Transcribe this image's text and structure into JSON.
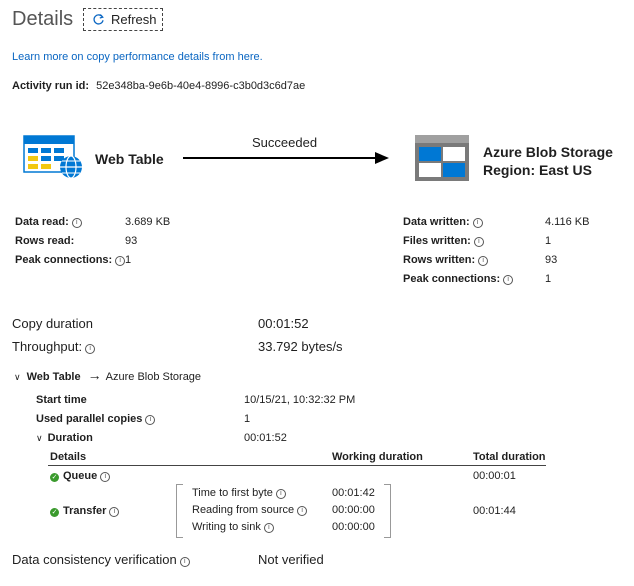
{
  "header": {
    "title": "Details",
    "refresh_label": "Refresh"
  },
  "link_text": "Learn more on copy performance details from here.",
  "activity_run": {
    "label": "Activity run id:",
    "value": "52e348ba-9e6b-40e4-8996-c3b0d3c6d7ae"
  },
  "flow": {
    "source": "Web Table",
    "destination_line1": "Azure Blob Storage",
    "destination_line2": "Region: East US",
    "status": "Succeeded"
  },
  "source_stats": [
    {
      "label": "Data read:",
      "value": "3.689 KB"
    },
    {
      "label": "Rows read:",
      "value": "93"
    },
    {
      "label": "Peak connections:",
      "value": "1"
    }
  ],
  "dest_stats": [
    {
      "label": "Data written:",
      "value": "4.116 KB"
    },
    {
      "label": "Files written:",
      "value": "1"
    },
    {
      "label": "Rows written:",
      "value": "93"
    },
    {
      "label": "Peak connections:",
      "value": "1"
    }
  ],
  "summary": {
    "copy_duration_label": "Copy duration",
    "copy_duration_value": "00:01:52",
    "throughput_label": "Throughput:",
    "throughput_value": "33.792 bytes/s"
  },
  "path": {
    "source": "Web Table",
    "arrow": "→",
    "destination": "Azure Blob Storage"
  },
  "run": {
    "start_label": "Start time",
    "start_value": "10/15/21, 10:32:32 PM",
    "parallel_label": "Used parallel copies",
    "parallel_value": "1",
    "duration_label": "Duration",
    "duration_value": "00:01:52"
  },
  "table": {
    "col_details": "Details",
    "col_working": "Working duration",
    "col_total": "Total duration",
    "queue_label": "Queue",
    "queue_total": "00:00:01",
    "transfer_label": "Transfer",
    "transfer_total": "00:01:44",
    "sub": [
      {
        "label": "Time to first byte",
        "value": "00:01:42"
      },
      {
        "label": "Reading from source",
        "value": "00:00:00"
      },
      {
        "label": "Writing to sink",
        "value": "00:00:00"
      }
    ]
  },
  "verification": {
    "label": "Data consistency verification",
    "value": "Not verified"
  },
  "colors": {
    "link": "#0a66c2",
    "success": "#3a9a2d",
    "azure_blue": "#0078d4",
    "table_yellow": "#f2c811"
  }
}
